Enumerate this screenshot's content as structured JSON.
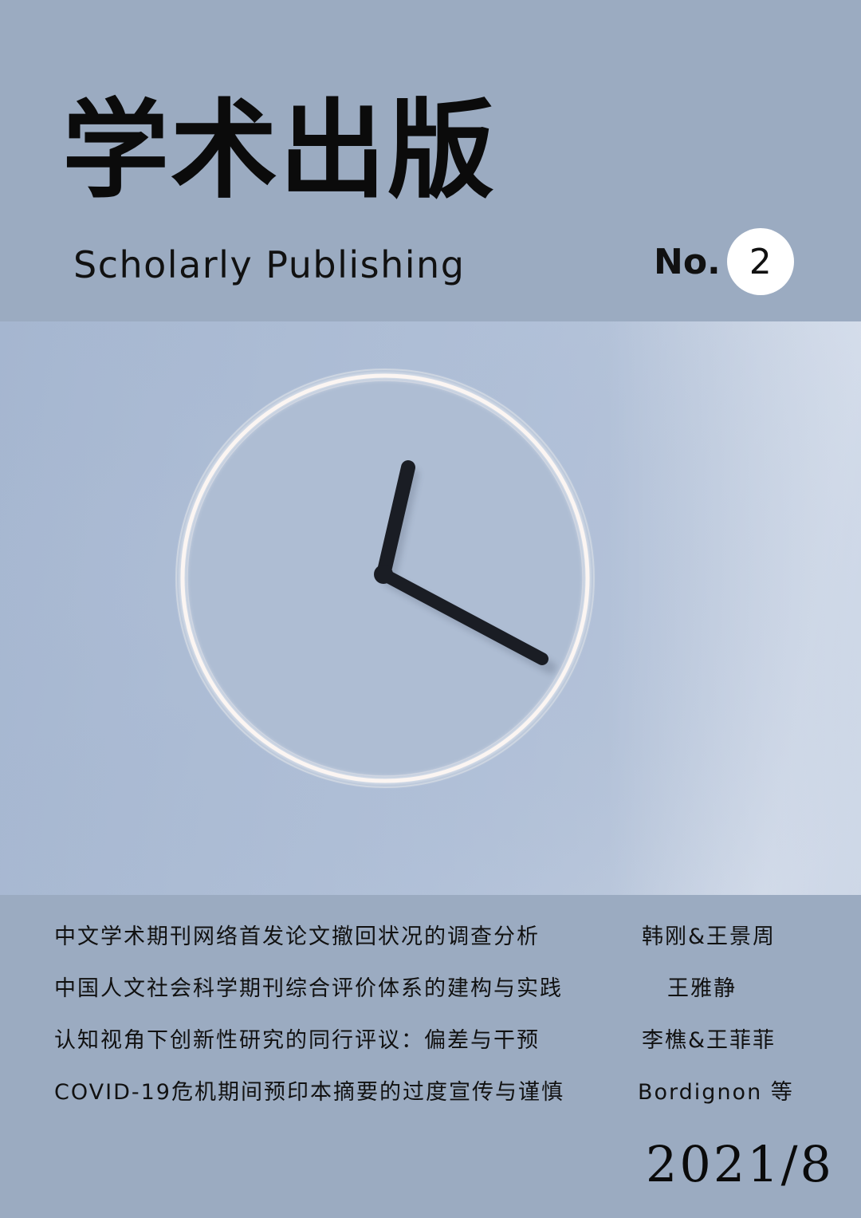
{
  "cover": {
    "title_cn": "学术出版",
    "title_en": "Scholarly Publishing",
    "issue_prefix": "No.",
    "issue_number": "2",
    "date": "2021/8"
  },
  "photo": {
    "subject": "clock-icon",
    "background_color": "#adbdd5",
    "ring_color": "#fbf5f2",
    "hands_color": "#1a1d24"
  },
  "articles": [
    {
      "title": "中文学术期刊网络首发论文撤回状况的调查分析",
      "authors": "韩刚&王景周"
    },
    {
      "title": "中国人文社会科学期刊综合评价体系的建构与实践",
      "authors": "王雅静"
    },
    {
      "title": "认知视角下创新性研究的同行评议：偏差与干预",
      "authors": "李樵&王菲菲"
    },
    {
      "title": "COVID-19危机期间预印本摘要的过度宣传与谨慎",
      "authors": "Bordignon 等"
    }
  ]
}
